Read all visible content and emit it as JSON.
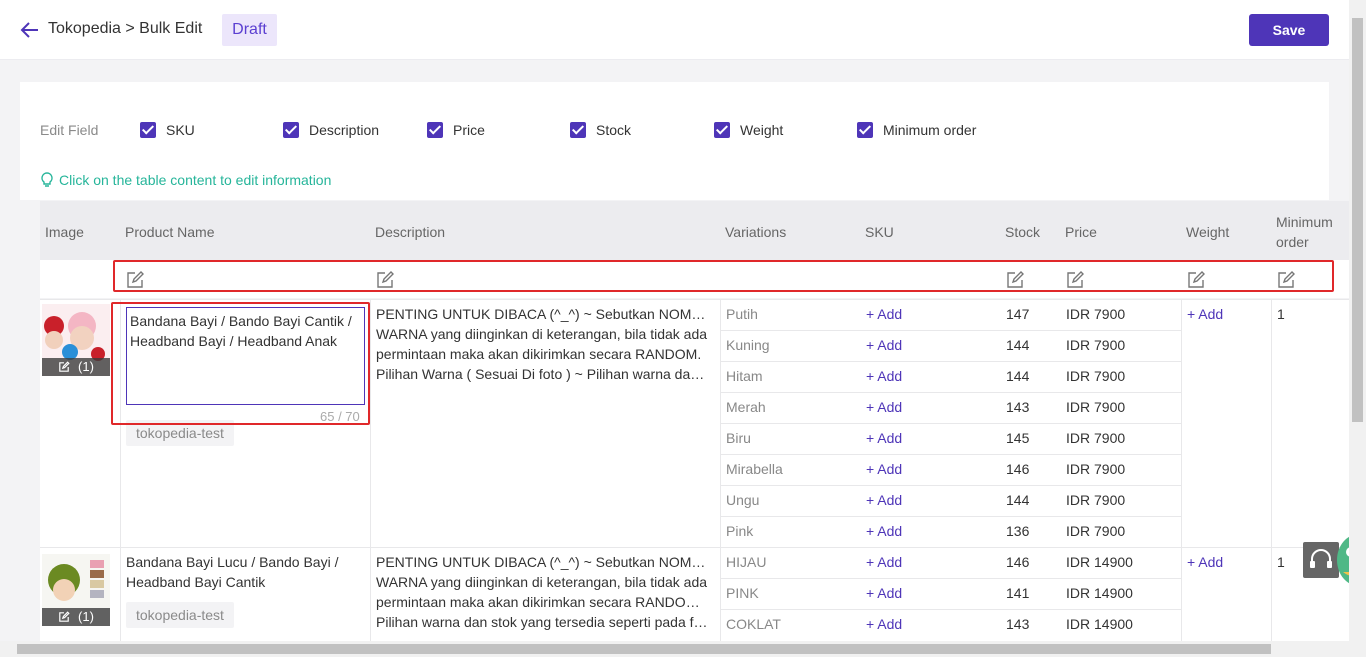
{
  "header": {
    "breadcrumb": "Tokopedia > Bulk Edit",
    "status_badge": "Draft",
    "save_label": "Save"
  },
  "edit_fields": {
    "label": "Edit Field",
    "options": [
      {
        "label": "SKU",
        "checked": true
      },
      {
        "label": "Description",
        "checked": true
      },
      {
        "label": "Price",
        "checked": true
      },
      {
        "label": "Stock",
        "checked": true
      },
      {
        "label": "Weight",
        "checked": true
      },
      {
        "label": "Minimum order",
        "checked": true
      }
    ]
  },
  "tip": "Click on the table content to edit information",
  "table": {
    "columns": [
      "Image",
      "Product Name",
      "Description",
      "Variations",
      "SKU",
      "Stock",
      "Price",
      "Weight",
      "Minimum",
      "order"
    ],
    "products": [
      {
        "image_count": "(1)",
        "name": "Bandana Bayi / Bando Bayi Cantik / Headband Bayi /  Headband Anak",
        "name_counter": "65 / 70",
        "tag": "tokopedia-test",
        "description_lines": [
          "PENTING UNTUK DIBACA (^_^) ~ Sebutkan NOMOR",
          "WARNA yang diinginkan di keterangan, bila tidak ada",
          "permintaan maka akan dikirimkan secara RANDOM.",
          "Pilihan Warna ( Sesuai Di foto ) ~ Pilihan warna dan stok"
        ],
        "weight_add": "+ Add",
        "min_order": "1",
        "variations": [
          {
            "name": "Putih",
            "sku": "+ Add",
            "stock": "147",
            "price": "IDR 7900"
          },
          {
            "name": "Kuning",
            "sku": "+ Add",
            "stock": "144",
            "price": "IDR 7900"
          },
          {
            "name": "Hitam",
            "sku": "+ Add",
            "stock": "144",
            "price": "IDR 7900"
          },
          {
            "name": "Merah",
            "sku": "+ Add",
            "stock": "143",
            "price": "IDR 7900"
          },
          {
            "name": "Biru",
            "sku": "+ Add",
            "stock": "145",
            "price": "IDR 7900"
          },
          {
            "name": "Mirabella",
            "sku": "+ Add",
            "stock": "146",
            "price": "IDR 7900"
          },
          {
            "name": "Ungu",
            "sku": "+ Add",
            "stock": "144",
            "price": "IDR 7900"
          },
          {
            "name": "Pink",
            "sku": "+ Add",
            "stock": "136",
            "price": "IDR 7900"
          }
        ]
      },
      {
        "image_count": "(1)",
        "name_lines": [
          "Bandana Bayi Lucu / Bando Bayi /",
          "Headband Bayi Cantik"
        ],
        "tag": "tokopedia-test",
        "description_lines": [
          "PENTING UNTUK DIBACA (^_^) ~ Sebutkan NOMOR",
          "WARNA yang diinginkan di keterangan, bila tidak ada",
          "permintaan maka akan dikirimkan secara RANDOM. ~",
          "Pilihan warna dan stok yang tersedia seperti pada foto"
        ],
        "weight_add": "+ Add",
        "min_order": "1",
        "variations": [
          {
            "name": "HIJAU",
            "sku": "+ Add",
            "stock": "146",
            "price": "IDR 14900"
          },
          {
            "name": "PINK",
            "sku": "+ Add",
            "stock": "141",
            "price": "IDR 14900"
          },
          {
            "name": "COKLAT",
            "sku": "+ Add",
            "stock": "143",
            "price": "IDR 14900"
          }
        ]
      }
    ]
  },
  "colors": {
    "accent": "#4e35b8",
    "highlight": "#e0282a",
    "tip": "#26b59a"
  }
}
